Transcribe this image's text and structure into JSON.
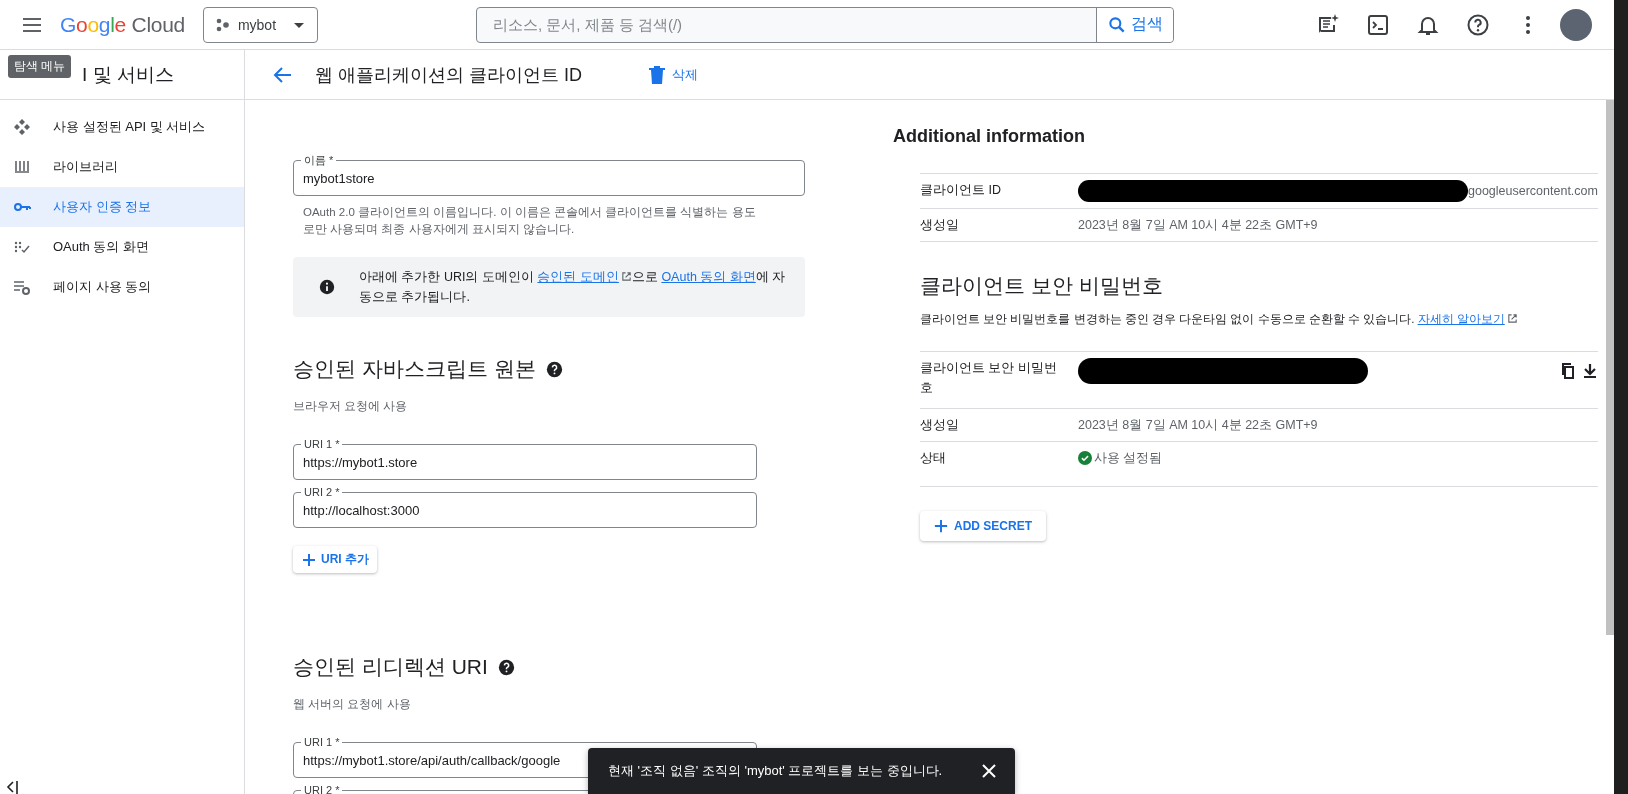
{
  "topbar": {
    "brand": "Google",
    "product": "Cloud",
    "project": "mybot",
    "search_placeholder": "리소스, 문서, 제품 등 검색(/)",
    "search_button": "검색"
  },
  "tooltip": "탐색 메뉴",
  "sidebar": {
    "title": "I 및 서비스",
    "items": [
      {
        "label": "사용 설정된 API 및 서비스",
        "selected": false
      },
      {
        "label": "라이브러리",
        "selected": false
      },
      {
        "label": "사용자 인증 정보",
        "selected": true
      },
      {
        "label": "OAuth 동의 화면",
        "selected": false
      },
      {
        "label": "페이지 사용 동의",
        "selected": false
      }
    ]
  },
  "page_header": {
    "title": "웹 애플리케이션의 클라이언트 ID",
    "delete": "삭제"
  },
  "name_field": {
    "label": "이름 *",
    "value": "mybot1store",
    "hint": "OAuth 2.0 클라이언트의 이름입니다. 이 이름은 콘솔에서 클라이언트를 식별하는 용도로만 사용되며 최종 사용자에게 표시되지 않습니다."
  },
  "info_box": {
    "parts": [
      {
        "kind": "text",
        "text": "아래에 추가한 URI의 도메인이 "
      },
      {
        "kind": "link",
        "text": "승인된 도메인",
        "external": true
      },
      {
        "kind": "text",
        "text": "으로 "
      },
      {
        "kind": "link",
        "text": "OAuth 동의 화면",
        "external": false
      },
      {
        "kind": "text",
        "text": "에 자동으로 추가됩니다."
      }
    ]
  },
  "js_origins": {
    "title": "승인된 자바스크립트 원본",
    "subtitle": "브라우저 요청에 사용",
    "uris": [
      {
        "label": "URI 1 *",
        "value": "https://mybot1.store"
      },
      {
        "label": "URI 2 *",
        "value": "http://localhost:3000"
      }
    ],
    "add_button": "URI 추가"
  },
  "redirect_uris": {
    "title": "승인된 리디렉션 URI",
    "subtitle": "웹 서버의 요청에 사용",
    "uris": [
      {
        "label": "URI 1 *",
        "value": "https://mybot1.store/api/auth/callback/google"
      },
      {
        "label": "URI 2 *"
      }
    ]
  },
  "additional": {
    "title": "Additional information",
    "rows": [
      {
        "label": "클라이언트 ID",
        "value": "googleusercontent.com",
        "redacted": true
      },
      {
        "label": "생성일",
        "value": "2023년 8월 7일 AM 10시 4분 22초 GMT+9",
        "redacted": false
      }
    ]
  },
  "secret": {
    "title": "클라이언트 보안 비밀번호",
    "description": "클라이언트 보안 비밀번호를 변경하는 중인 경우 다운타임 없이 수동으로 순환할 수 있습니다.",
    "learn_more": "자세히 알아보기",
    "rows": [
      {
        "kind": "secret",
        "label": "클라이언트 보안 비밀번호",
        "redacted": true
      },
      {
        "kind": "text",
        "label": "생성일",
        "value": "2023년 8월 7일 AM 10시 4분 22초 GMT+9"
      },
      {
        "kind": "status",
        "label": "상태",
        "value": "사용 설정됨"
      }
    ],
    "add_button": "ADD SECRET"
  },
  "snackbar": {
    "message": "현재 '조직 없음' 조직의 'mybot' 프로젝트를 보는 중입니다."
  }
}
